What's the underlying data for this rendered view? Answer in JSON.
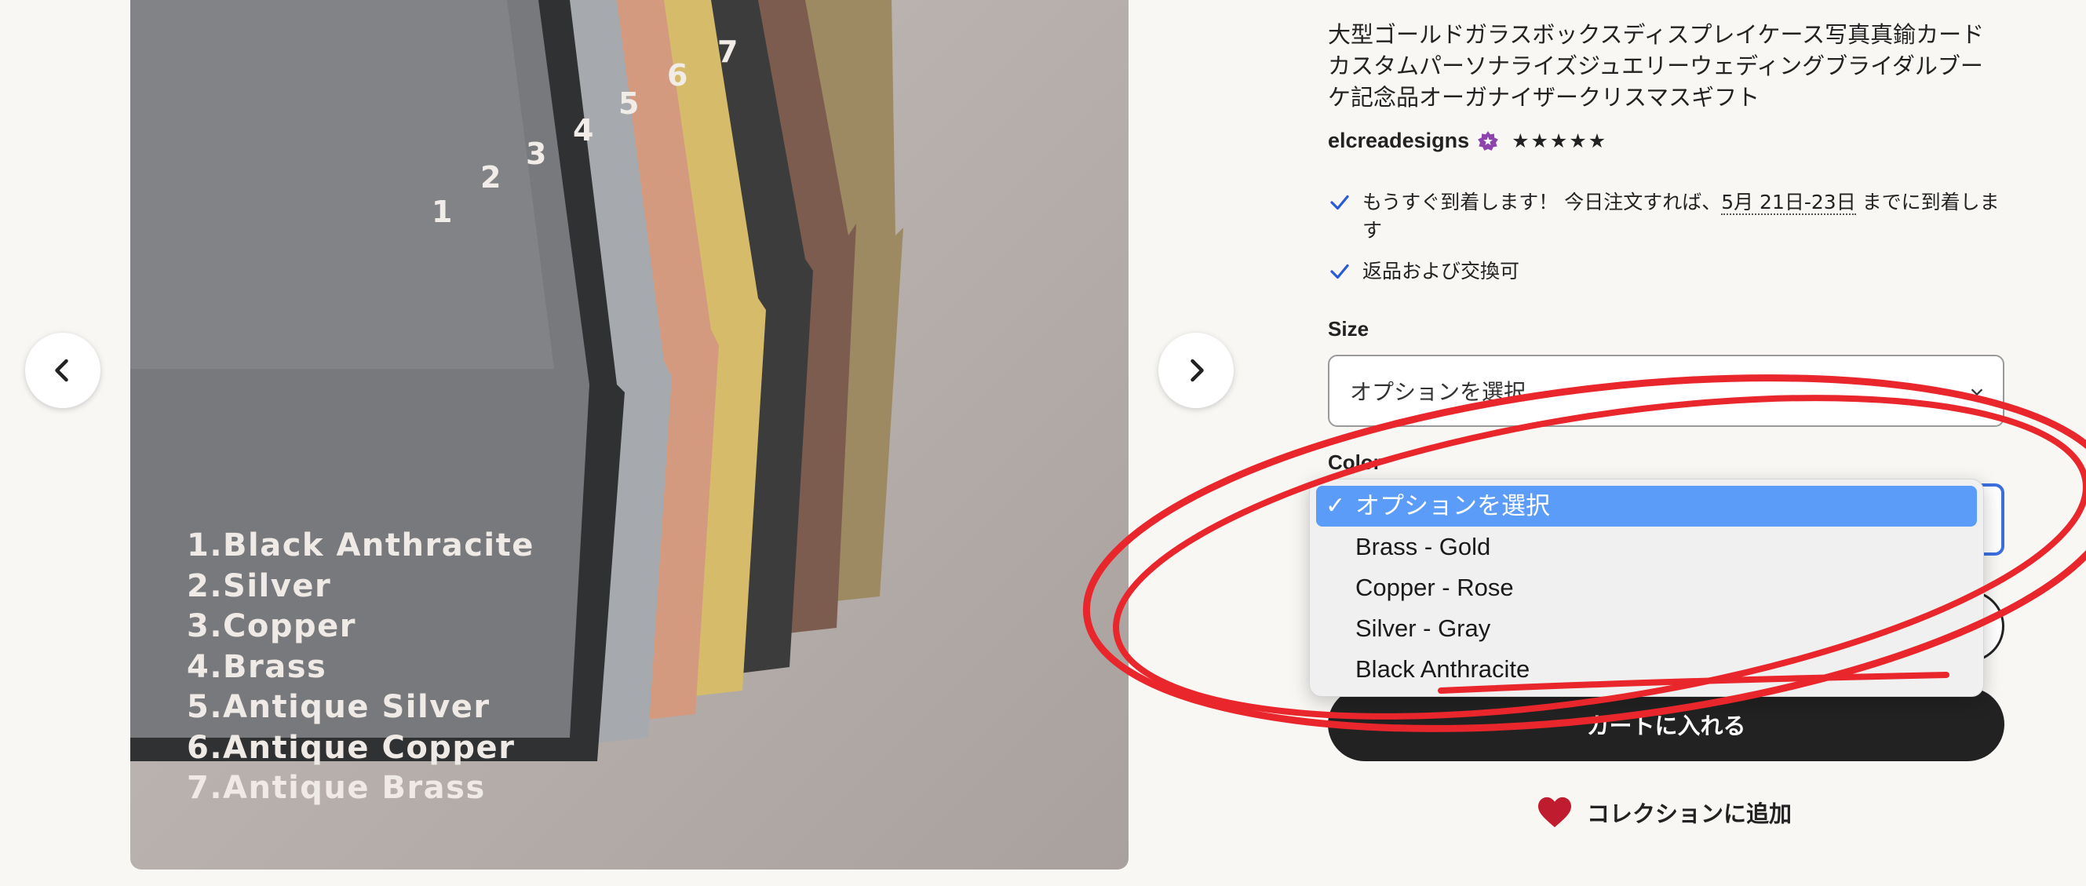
{
  "gallery": {
    "legend": [
      "1.Black Anthracite",
      "2.Silver",
      "3.Copper",
      "4.Brass",
      "5.Antique Silver",
      "6.Antique Copper",
      "7.Antique Brass"
    ],
    "frame_numbers": [
      "1",
      "2",
      "3",
      "4",
      "5",
      "6",
      "7"
    ],
    "prev_icon": "chevron-left-icon",
    "next_icon": "chevron-right-icon"
  },
  "listing": {
    "title": "大型ゴールドガラスボックスディスプレイケース写真真鍮カードカスタムパーソナライズジュエリーウェディングブライダルブーケ記念品オーガナイザークリスマスギフト",
    "shop_name": "elcreadesigns",
    "stars": "★★★★★",
    "delivery_prefix": "もうすぐ到着します！ 今日注文すれば、",
    "delivery_date": "5月 21日-23日",
    "delivery_suffix": " までに到着します",
    "returns": "返品および交換可"
  },
  "size": {
    "label": "Size",
    "value": "オプションを選択"
  },
  "color": {
    "label": "Color",
    "options": [
      {
        "label": "オプションを選択",
        "selected": true
      },
      {
        "label": "Brass - Gold"
      },
      {
        "label": "Copper - Rose"
      },
      {
        "label": "Silver - Gray"
      },
      {
        "label": "Black Anthracite"
      }
    ],
    "tick": "✓"
  },
  "buttons": {
    "add_to_cart": "カートに入れる",
    "add_to_collection": "コレクションに追加"
  },
  "colors": {
    "accent_blue": "#5a9cf8",
    "annotation_red": "#e8262b",
    "cart_bg": "#222222",
    "heart": "#c01c2f"
  }
}
